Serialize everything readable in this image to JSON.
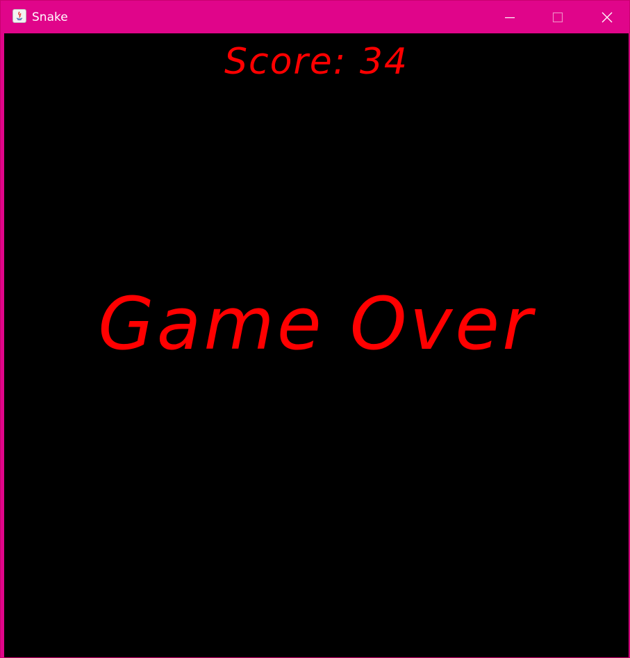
{
  "window": {
    "title": "Snake",
    "app_icon": "java-icon",
    "titlebar_color": "#e0058a",
    "controls": {
      "minimize": "minimize-icon",
      "maximize": "maximize-icon",
      "close": "close-icon"
    }
  },
  "game": {
    "background_color": "#000000",
    "text_color": "#ff0000",
    "score_text": "Score: 34",
    "status_text": "Game Over"
  }
}
